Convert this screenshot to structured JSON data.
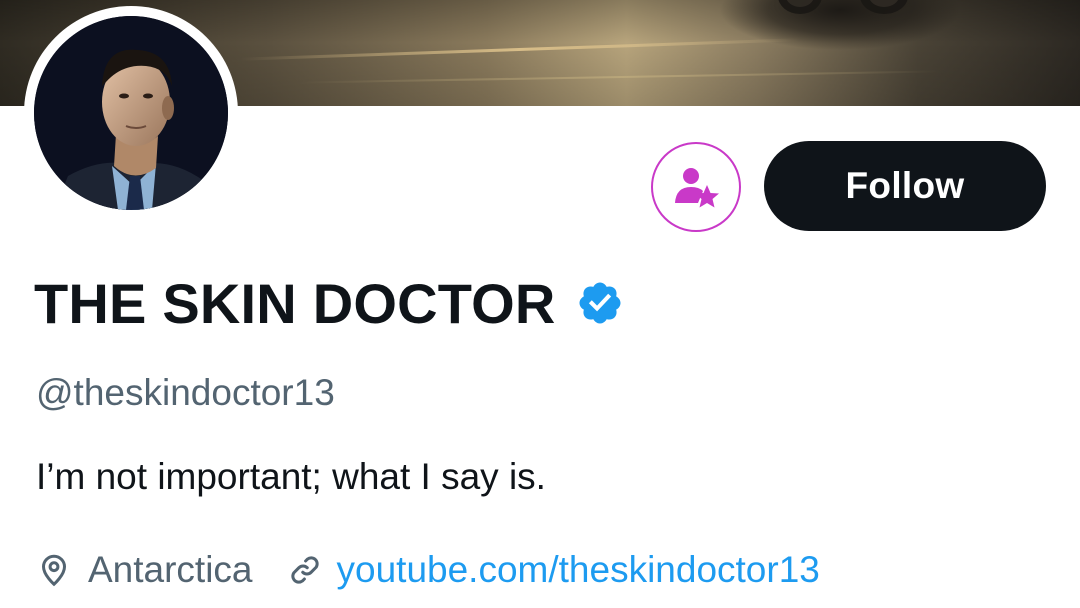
{
  "profile": {
    "display_name": "THE SKIN DOCTOR",
    "handle": "@theskindoctor13",
    "bio": "I’m not important; what I say is.",
    "location": "Antarctica",
    "website": "youtube.com/theskindoctor13",
    "verified": true
  },
  "actions": {
    "follow_label": "Follow",
    "subscribe_icon": "person-star-icon"
  },
  "icons": {
    "verified": "verified-badge-icon",
    "location": "location-pin-icon",
    "link": "link-icon"
  },
  "colors": {
    "follow_button_bg": "#0f1419",
    "subscribe_accent": "#c939c8",
    "verified_blue": "#1d9bf0",
    "link_blue": "#1d9bf0",
    "secondary_text": "#536471",
    "primary_text": "#0f1419"
  }
}
